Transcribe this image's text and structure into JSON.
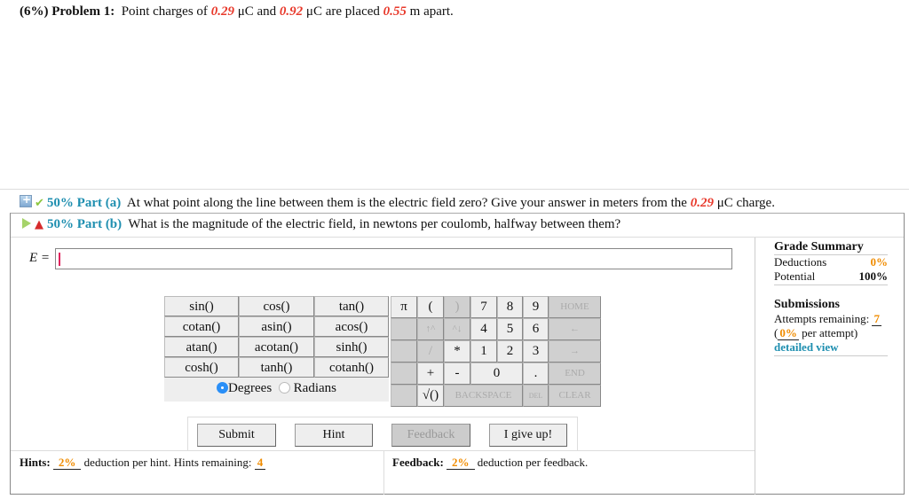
{
  "problem": {
    "weight": "(6%)",
    "label": "Problem 1:",
    "text_1": "Point charges of",
    "charge_1": "0.29",
    "unit_1": "μC and",
    "charge_2": "0.92",
    "unit_2": "μC are placed",
    "distance": "0.55",
    "text_end": "m apart."
  },
  "part_a": {
    "status": "correct",
    "weight": "50%",
    "label": "Part (a)",
    "question_1": "At what point along the line between them is the electric field zero? Give your answer in meters from the",
    "charge": "0.29",
    "question_2": "μC charge."
  },
  "part_b": {
    "status": "active-warning",
    "weight": "50%",
    "label": "Part (b)",
    "question": "What is the magnitude of the electric field, in newtons per coulomb, halfway between them?"
  },
  "answer": {
    "label": "E =",
    "value": ""
  },
  "grade_summary": {
    "title": "Grade Summary",
    "deductions_label": "Deductions",
    "deductions_value": "0%",
    "potential_label": "Potential",
    "potential_value": "100%"
  },
  "submissions": {
    "title": "Submissions",
    "attempts_label": "Attempts remaining:",
    "attempts_value": "7",
    "per_attempt_open": "(",
    "per_attempt_value": "0%",
    "per_attempt_text": "per attempt)",
    "detailed_view": "detailed view"
  },
  "trig_buttons": [
    "sin()",
    "cos()",
    "tan()",
    "cotan()",
    "asin()",
    "acos()",
    "atan()",
    "acotan()",
    "sinh()",
    "cosh()",
    "tanh()",
    "cotanh()"
  ],
  "angle_mode": {
    "degrees": "Degrees",
    "radians": "Radians",
    "selected": "Degrees"
  },
  "keypad": {
    "pi": "π",
    "lparen": "(",
    "rparen": ")",
    "k7": "7",
    "k8": "8",
    "k9": "9",
    "home": "HOME",
    "up": "↑^",
    "down": "^↓",
    "k4": "4",
    "k5": "5",
    "k6": "6",
    "left": "←",
    "divide": "/",
    "multiply": "*",
    "k1": "1",
    "k2": "2",
    "k3": "3",
    "right": "→",
    "plus": "+",
    "minus": "-",
    "k0": "0",
    "dot": ".",
    "end": "END",
    "sqrt": "√()",
    "backspace": "BACKSPACE",
    "del": "DEL",
    "clear": "CLEAR"
  },
  "actions": {
    "submit": "Submit",
    "hint": "Hint",
    "feedback": "Feedback",
    "give_up": "I give up!"
  },
  "hints": {
    "label": "Hints:",
    "deduction": "2%",
    "text": "deduction per hint. Hints remaining:",
    "remaining": "4"
  },
  "feedback": {
    "label": "Feedback:",
    "deduction": "2%",
    "text": "deduction per feedback."
  }
}
